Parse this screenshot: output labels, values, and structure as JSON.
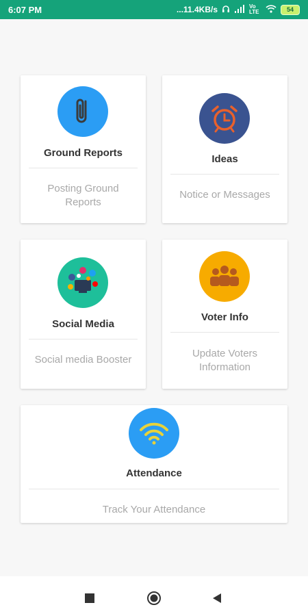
{
  "status_bar": {
    "time": "6:07 PM",
    "net_speed": "...11.4KB/s",
    "volte": "Vo LTE",
    "battery": "54"
  },
  "cards": [
    {
      "title": "Ground Reports",
      "subtitle": "Posting Ground Reports",
      "icon": "paperclip-icon",
      "color": "#2b9df4"
    },
    {
      "title": "Ideas",
      "subtitle": "Notice or Messages",
      "icon": "alarm-clock-icon",
      "color": "#3a5390"
    },
    {
      "title": "Social Media",
      "subtitle": "Social media Booster",
      "icon": "social-media-icon",
      "color": "#1ebf9a"
    },
    {
      "title": "Voter Info",
      "subtitle": "Update Voters Information",
      "icon": "people-group-icon",
      "color": "#f7ab00"
    },
    {
      "title": "Attendance",
      "subtitle": "Track Your Attendance",
      "icon": "wifi-icon",
      "color": "#2b9df4"
    }
  ],
  "nav": {
    "icons": [
      "recents-square-icon",
      "home-circle-icon",
      "back-triangle-icon"
    ]
  }
}
